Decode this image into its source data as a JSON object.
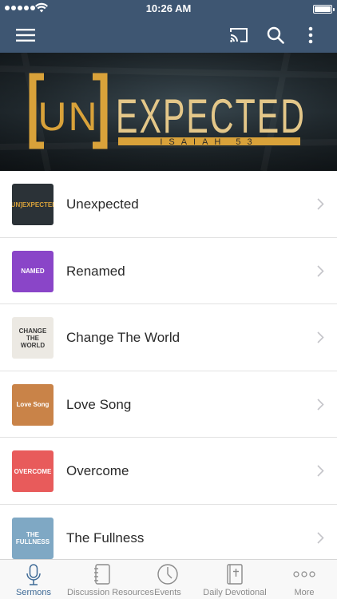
{
  "status_bar": {
    "time": "10:26 AM",
    "battery_level": 1.0
  },
  "nav_bar": {
    "icons": [
      "menu-icon",
      "cast-icon",
      "search-icon",
      "more-vertical-icon"
    ]
  },
  "banner": {
    "title_bracket": "UN",
    "title_main": "EXPECTED",
    "subtitle": "ISAIAH 53"
  },
  "sermons": [
    {
      "title": "Unexpected",
      "thumb": {
        "text": "[UN]EXPECTED",
        "bg": "#2b3237",
        "accent": "#d9a23a"
      }
    },
    {
      "title": "Renamed",
      "thumb": {
        "text": "NAMED",
        "bg": "#8a45c8",
        "accent": "#ffffff"
      }
    },
    {
      "title": "Change The World",
      "thumb": {
        "text": "CHANGE THE WORLD",
        "bg": "#ece9e3",
        "accent": "#3a3a3a"
      }
    },
    {
      "title": "Love Song",
      "thumb": {
        "text": "Love Song",
        "bg": "#c98348",
        "accent": "#ffffff"
      }
    },
    {
      "title": "Overcome",
      "thumb": {
        "text": "OVERCOME",
        "bg": "#e85b5b",
        "accent": "#ffffff"
      }
    },
    {
      "title": "The Fullness",
      "thumb": {
        "text": "THE FULLNESS",
        "bg": "#7fa8c4",
        "accent": "#ffffff"
      }
    }
  ],
  "tab_bar": {
    "tabs": [
      {
        "label": "Sermons",
        "icon": "microphone-icon",
        "active": true
      },
      {
        "label": "Discussion Resources",
        "icon": "notebook-icon",
        "active": false
      },
      {
        "label": "Events",
        "icon": "clock-icon",
        "active": false
      },
      {
        "label": "Daily Devotional",
        "icon": "bible-icon",
        "active": false
      },
      {
        "label": "More",
        "icon": "more-dots-icon",
        "active": false
      }
    ]
  },
  "colors": {
    "bar": "#3e5672",
    "accent": "#3e6a96",
    "banner_gold": "#d9a23a"
  }
}
